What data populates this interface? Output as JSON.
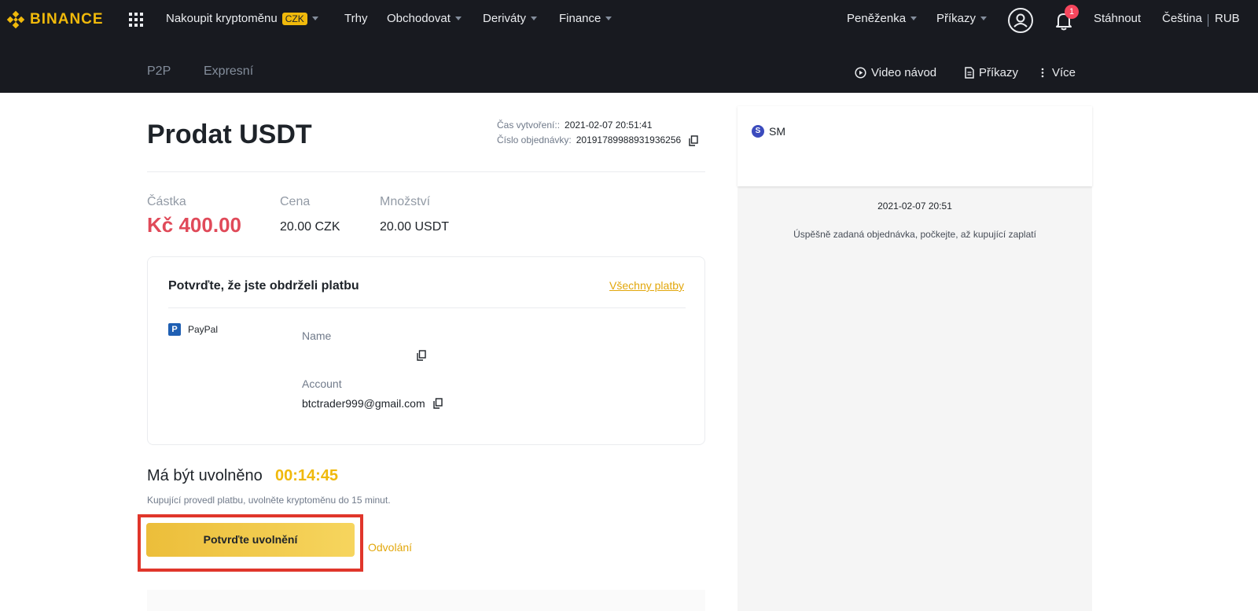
{
  "brand": {
    "name": "BINANCE",
    "color": "#F0B90B"
  },
  "topnav": {
    "buy_crypto": "Nakoupit kryptoměnu",
    "currency_badge": "CZK",
    "markets": "Trhy",
    "trade": "Obchodovat",
    "derivatives": "Deriváty",
    "finance": "Finance",
    "wallet": "Peněženka",
    "orders": "Příkazy",
    "notification_count": "1",
    "download": "Stáhnout",
    "language": "Čeština",
    "currency_cut": "RUB"
  },
  "subnav": {
    "tab_p2p": "P2P",
    "tab_express": "Expresní",
    "video": "Video návod",
    "orders": "Příkazy",
    "more": "Více"
  },
  "order": {
    "title": "Prodat USDT",
    "created_label": "Čas vytvoření::",
    "created_value": "2021-02-07 20:51:41",
    "number_label": "Číslo objednávky:",
    "number_value": "20191789988931936256",
    "amount_label": "Částka",
    "amount_value": "Kč 400.00",
    "price_label": "Cena",
    "price_value": "20.00 CZK",
    "qty_label": "Množství",
    "qty_value": "20.00 USDT"
  },
  "payment": {
    "title": "Potvrďte, že jste obdrželi platbu",
    "all_payments": "Všechny platby",
    "method": "PayPal",
    "name_label": "Name",
    "name_value": "",
    "account_label": "Account",
    "account_value": "btctrader999@gmail.com"
  },
  "release": {
    "label": "Má být uvolněno",
    "timer": "00:14:45",
    "hint": "Kupující provedl platbu, uvolněte kryptoměnu do 15 minut.",
    "confirm_button": "Potvrďte uvolnění",
    "appeal": "Odvolání"
  },
  "chat": {
    "user_initial": "S",
    "user_name": "SM",
    "timestamp": "2021-02-07 20:51",
    "message": "Úspěšně zadaná objednávka, počkejte, až kupující zaplatí"
  },
  "colors": {
    "nav_bg": "#181A20",
    "accent": "#F0B90B",
    "amount_red": "#E04A59",
    "highlight_border": "#E0362B"
  }
}
